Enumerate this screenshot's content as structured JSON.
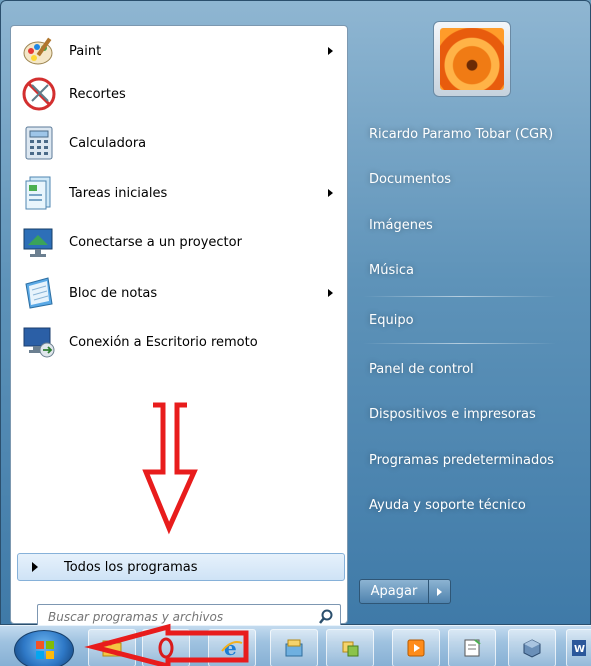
{
  "start_menu": {
    "programs": [
      {
        "label": "Paint",
        "icon": "paint-icon",
        "has_submenu": true
      },
      {
        "label": "Recortes",
        "icon": "scissors-icon",
        "has_submenu": false
      },
      {
        "label": "Calculadora",
        "icon": "calculator-icon",
        "has_submenu": false
      },
      {
        "label": "Tareas iniciales",
        "icon": "getting-started-icon",
        "has_submenu": true
      },
      {
        "label": "Conectarse a un proyector",
        "icon": "projector-icon",
        "has_submenu": false
      },
      {
        "label": "Bloc de notas",
        "icon": "notepad-icon",
        "has_submenu": true
      },
      {
        "label": "Conexión a Escritorio remoto",
        "icon": "remote-desktop-icon",
        "has_submenu": false
      }
    ],
    "all_programs_label": "Todos los programas",
    "search": {
      "placeholder": "Buscar programas y archivos"
    },
    "right_pane": {
      "user_name": "Ricardo Paramo Tobar (CGR)",
      "items": [
        "Documentos",
        "Imágenes",
        "Música",
        "Equipo",
        "Panel de control",
        "Dispositivos e impresoras",
        "Programas predeterminados",
        "Ayuda y soporte técnico"
      ]
    },
    "shutdown_label": "Apagar"
  },
  "taskbar": {
    "pinned": [
      "explorer-icon",
      "opera-icon",
      "ie-icon",
      "folder-icon",
      "paint-icon",
      "media-player-icon",
      "notepad-icon",
      "virtualbox-icon",
      "word-icon"
    ]
  },
  "colors": {
    "annotation_arrow": "#e81c1c",
    "all_programs_highlight": "#cfe3f6",
    "menu_glass": "#5e93b9"
  }
}
